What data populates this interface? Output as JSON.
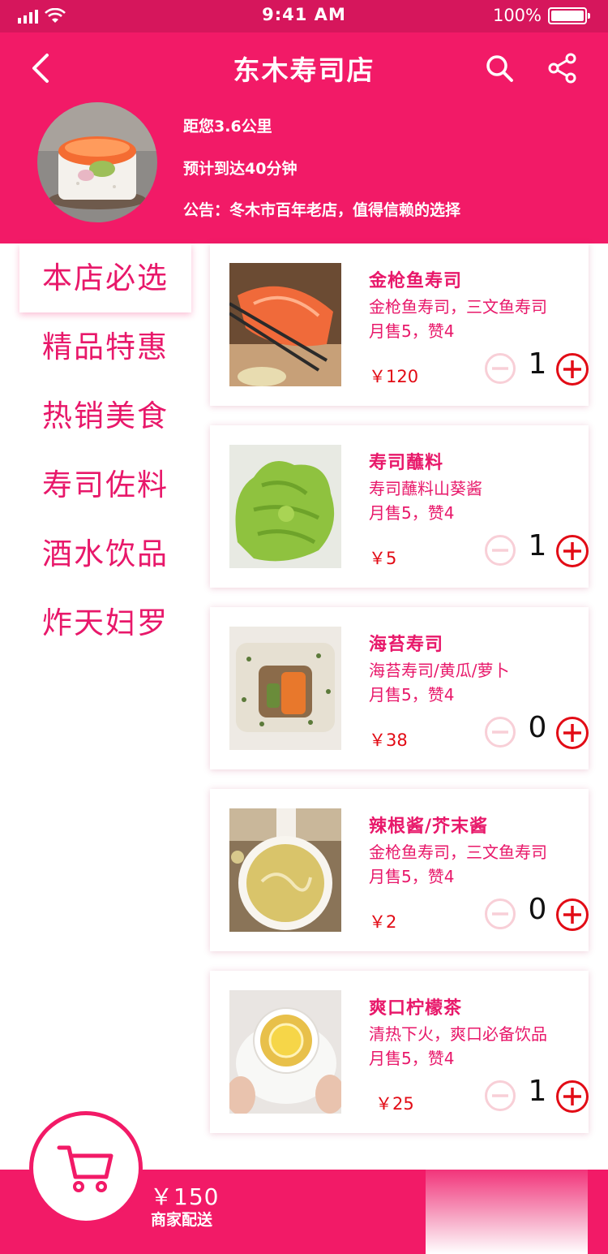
{
  "status_bar": {
    "time": "9:41 AM",
    "battery": "100%"
  },
  "header": {
    "title": "东木寿司店",
    "distance": "距您3.6公里",
    "eta": "预计到达40分钟",
    "notice": "公告：冬木市百年老店，值得信赖的选择"
  },
  "categories": [
    {
      "label": "本店必选",
      "active": true
    },
    {
      "label": "精品特惠"
    },
    {
      "label": "热销美食"
    },
    {
      "label": "寿司佐料"
    },
    {
      "label": "酒水饮品"
    },
    {
      "label": "炸天妇罗"
    }
  ],
  "products": [
    {
      "name": "金枪鱼寿司",
      "desc": "金枪鱼寿司，三文鱼寿司",
      "sales": "月售5，赞4",
      "price": "￥120",
      "qty": "1",
      "image": "salmon-sushi-photo"
    },
    {
      "name": "寿司蘸料",
      "desc": "寿司蘸料山葵酱",
      "sales": "月售5，赞4",
      "price": "￥5",
      "qty": "1",
      "image": "wasabi-photo"
    },
    {
      "name": "海苔寿司",
      "desc": "海苔寿司/黄瓜/萝卜",
      "sales": "月售5，赞4",
      "price": "￥38",
      "qty": "0",
      "image": "nori-roll-photo"
    },
    {
      "name": "辣根酱/芥末酱",
      "desc": "金枪鱼寿司，三文鱼寿司",
      "sales": "月售5，赞4",
      "price": "￥2",
      "qty": "0",
      "image": "mustard-sauce-photo"
    },
    {
      "name": "爽口柠檬茶",
      "desc": "清热下火，爽口必备饮品",
      "sales": "月售5，赞4",
      "price": "￥25",
      "qty": "1",
      "image": "lemon-tea-photo"
    }
  ],
  "cart": {
    "total": "￥150",
    "delivery": "商家配送"
  },
  "colors": {
    "brand": "#f21a67",
    "status_bar": "#d6165c",
    "price": "#e20b15",
    "text": "#e8186a"
  }
}
